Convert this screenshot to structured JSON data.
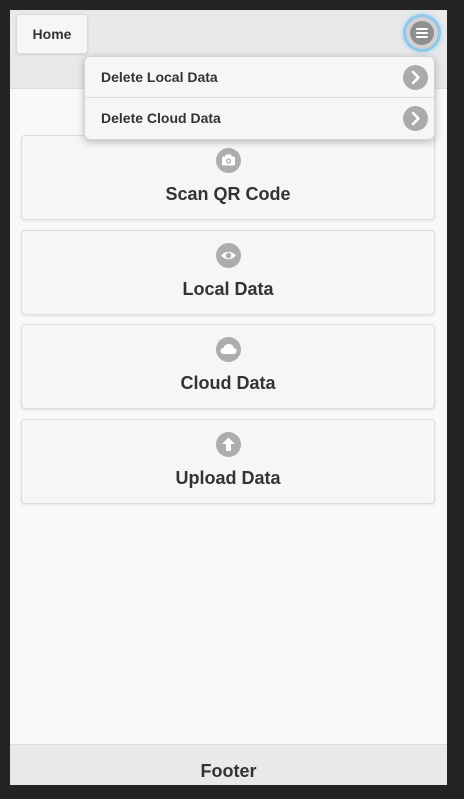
{
  "header": {
    "home_label": "Home",
    "menu_icon": "menu-icon"
  },
  "menu": {
    "items": [
      {
        "label": "Delete Local Data",
        "icon": "chevron-right-icon"
      },
      {
        "label": "Delete Cloud Data",
        "icon": "chevron-right-icon"
      }
    ]
  },
  "actions": [
    {
      "label": "Scan QR Code",
      "icon": "camera-icon"
    },
    {
      "label": "Local Data",
      "icon": "eye-icon"
    },
    {
      "label": "Cloud Data",
      "icon": "cloud-icon"
    },
    {
      "label": "Upload Data",
      "icon": "arrow-up-icon"
    }
  ],
  "footer": {
    "title": "Footer"
  },
  "colors": {
    "icon_gray": "#adadad",
    "focus_ring": "#8ec8ec",
    "page_background": "#232323"
  }
}
